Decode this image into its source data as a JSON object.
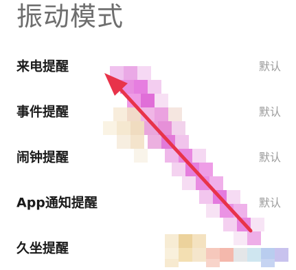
{
  "page": {
    "title": "振动模式"
  },
  "settings": [
    {
      "label": "来电提醒",
      "value": "默认"
    },
    {
      "label": "事件提醒",
      "value": "默认"
    },
    {
      "label": "闹钟提醒",
      "value": "默认"
    },
    {
      "label": "App通知提醒",
      "value": "默认"
    },
    {
      "label": "久坐提醒",
      "value": ""
    }
  ],
  "colors": {
    "title": "#6e6e6e",
    "label": "#1a1a1a",
    "value": "#9a9a9a",
    "arrow": "#e8334a",
    "mosaic_primary": "#e07ad8"
  },
  "overlay": {
    "arrow_icon": "red-arrow-icon",
    "mosaic": "pixelated-mosaic"
  }
}
